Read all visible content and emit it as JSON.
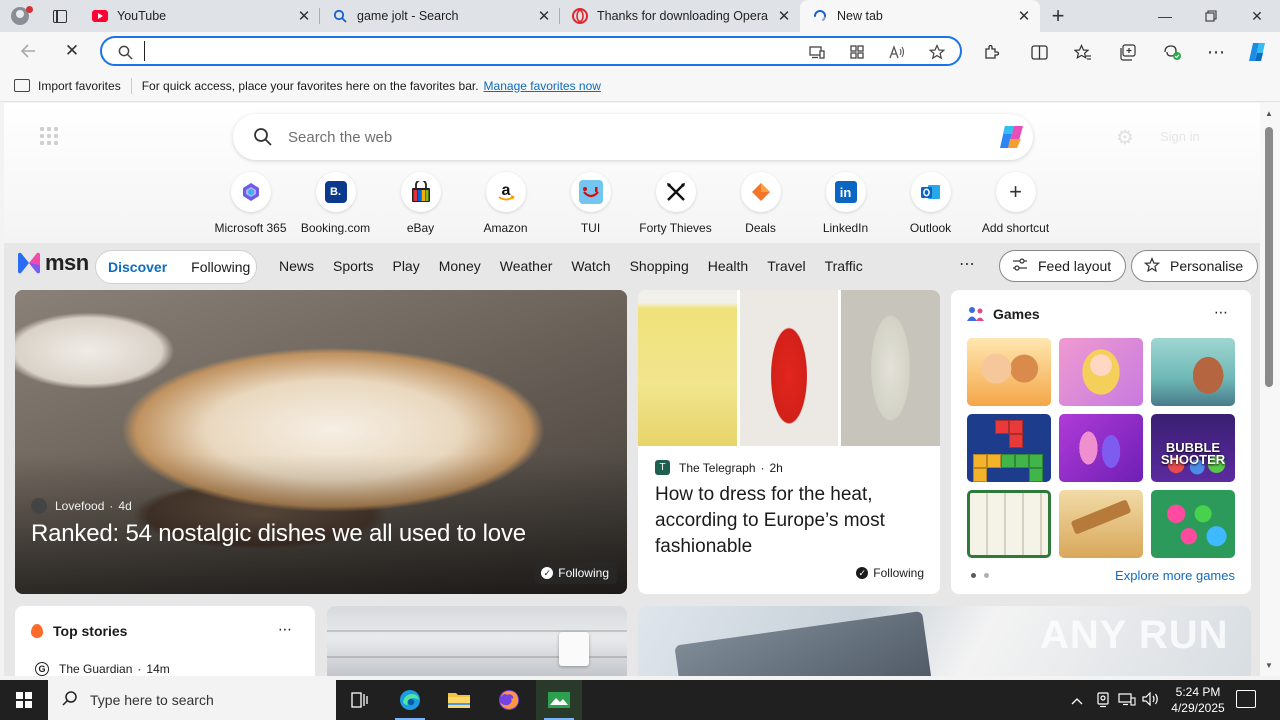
{
  "tabs": [
    {
      "title": "YouTube",
      "favicon": "youtube-icon"
    },
    {
      "title": "game jolt - Search",
      "favicon": "search-icon"
    },
    {
      "title": "Thanks for downloading Opera",
      "favicon": "opera-icon"
    },
    {
      "title": "New tab",
      "favicon": "loading-icon",
      "active": true
    }
  ],
  "address_bar": {
    "value": "",
    "placeholder": ""
  },
  "favorites_bar": {
    "import_label": "Import favorites",
    "message": "For quick access, place your favorites here on the favorites bar.",
    "manage_link": "Manage favorites now"
  },
  "newtab_search": {
    "placeholder": "Search the web"
  },
  "shortcuts": [
    {
      "label": "Microsoft 365",
      "icon": "m365-icon"
    },
    {
      "label": "Booking.com",
      "icon": "booking-icon"
    },
    {
      "label": "eBay",
      "icon": "ebay-icon"
    },
    {
      "label": "Amazon",
      "icon": "amazon-icon"
    },
    {
      "label": "TUI",
      "icon": "tui-icon"
    },
    {
      "label": "Forty Thieves",
      "icon": "forty-thieves-icon"
    },
    {
      "label": "Deals",
      "icon": "deals-icon"
    },
    {
      "label": "LinkedIn",
      "icon": "linkedin-icon"
    },
    {
      "label": "Outlook",
      "icon": "outlook-icon"
    },
    {
      "label": "Add shortcut",
      "icon": "plus-icon"
    }
  ],
  "msn": {
    "logo_text": "msn",
    "discover": "Discover",
    "following": "Following",
    "nav": [
      "News",
      "Sports",
      "Play",
      "Money",
      "Weather",
      "Watch",
      "Shopping",
      "Health",
      "Travel",
      "Traffic"
    ],
    "feed_layout": "Feed layout",
    "personalise": "Personalise"
  },
  "hero": {
    "source": "Lovefood",
    "age": "4d",
    "title": "Ranked: 54 nostalgic dishes we all used to love",
    "follow_label": "Following"
  },
  "telegraph": {
    "source": "The Telegraph",
    "age": "2h",
    "title": "How to dress for the heat, according to Europe’s most fashionable",
    "follow_label": "Following"
  },
  "games": {
    "heading": "Games",
    "tile_text": "BUBBLE SHOOTER",
    "explore_link": "Explore more games"
  },
  "top_stories": {
    "heading": "Top stories",
    "source": "The Guardian",
    "age": "14m"
  },
  "watermark": "ANY RUN",
  "taskbar": {
    "search_placeholder": "Type here to search",
    "time": "5:24 PM",
    "date": "4/29/2025"
  },
  "colors": {
    "accent": "#0f6cbd",
    "address_focus": "#1a73e8",
    "taskbar": "#202020"
  }
}
